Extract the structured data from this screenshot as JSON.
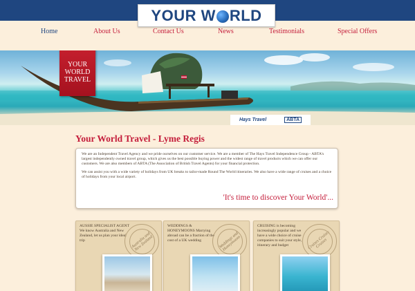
{
  "brand": {
    "logo_part1": "YOUR W",
    "logo_part2": "RLD"
  },
  "nav": [
    {
      "label": "Home"
    },
    {
      "label": "About Us"
    },
    {
      "label": "Contact Us"
    },
    {
      "label": "News"
    },
    {
      "label": "Testimonials"
    },
    {
      "label": "Special Offers"
    }
  ],
  "hero": {
    "ribbon_text": "YOUR WORLD TRAVEL",
    "partner_hays": "Hays Travel",
    "partner_abta": "ABTA"
  },
  "page": {
    "title": "Your World Travel - Lyme Regis",
    "intro_p1": "We are an Independent Travel Agency and we pride ourselves on our customer service. We are a member of The Hays Travel Independence Group - ABTA's largest independently owned travel group, which gives us the best possible buying power and the widest range of travel products which we can offer our customers. We are also members of ABTA (The Association of British Travel Agents) for your financial protection.",
    "intro_p2": "We can assist you with a wide variety of holidays from UK breaks to tailor-made Round The World itineraries. We also have a wide range of cruises and a choice of holidays from your local airport.",
    "tagline": "'It's time to discover Your World'..."
  },
  "cards": [
    {
      "heading": "AUSSIE SPECIALIST AGENT",
      "body": "We know Australia and New Zealand, let us plan your ideal trip",
      "stamp": "Australia and New Zealand"
    },
    {
      "heading": "WEDDINGS & HONEYMOONS",
      "body": "Marrying abroad can be a fraction of the cost of a UK wedding",
      "stamp": "Weddings and Honeymoons"
    },
    {
      "heading": "CRUISING",
      "body": "is becoming increasingly popular and we have a wide choice of cruise companies to suit your style, itinerary and budget",
      "stamp": "Cruises Cruises Cruises"
    }
  ]
}
